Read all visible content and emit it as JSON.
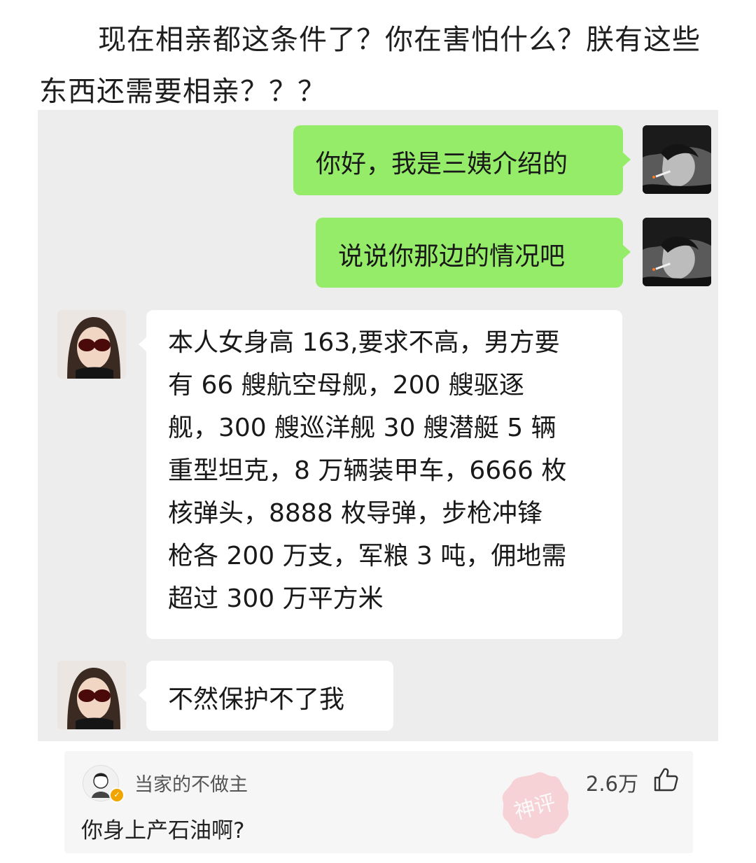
{
  "post": {
    "text": "现在相亲都这条件了？你在害怕什么？朕有这些东西还需要相亲？？？"
  },
  "chat": {
    "messages": [
      {
        "side": "right",
        "text": "你好，我是三姨介绍的"
      },
      {
        "side": "right",
        "text": "说说你那边的情况吧"
      },
      {
        "side": "left",
        "lines": [
          "本人女身高 163,要求不高，男方要",
          "有 66 艘航空母舰，200 艘驱逐",
          "舰，300 艘巡洋舰 30 艘潜艇 5 辆",
          "重型坦克，8 万辆装甲车，6666 枚",
          "核弹头，8888 枚导弹，步枪冲锋",
          "枪各 200 万支，军粮 3 吨，佣地需",
          "超过 300 万平方米"
        ]
      },
      {
        "side": "left",
        "text": "不然保护不了我"
      }
    ]
  },
  "comment": {
    "username": "当家的不做主",
    "likes": "2.6万",
    "text": "你身上产石油啊?",
    "stamp_text": "神评",
    "icons": {
      "like": "thumbs-up-icon",
      "badge": "verified-badge-icon"
    }
  },
  "colors": {
    "my_bubble": "#95ec69",
    "other_bubble": "#ffffff",
    "chat_bg": "#ededed"
  }
}
